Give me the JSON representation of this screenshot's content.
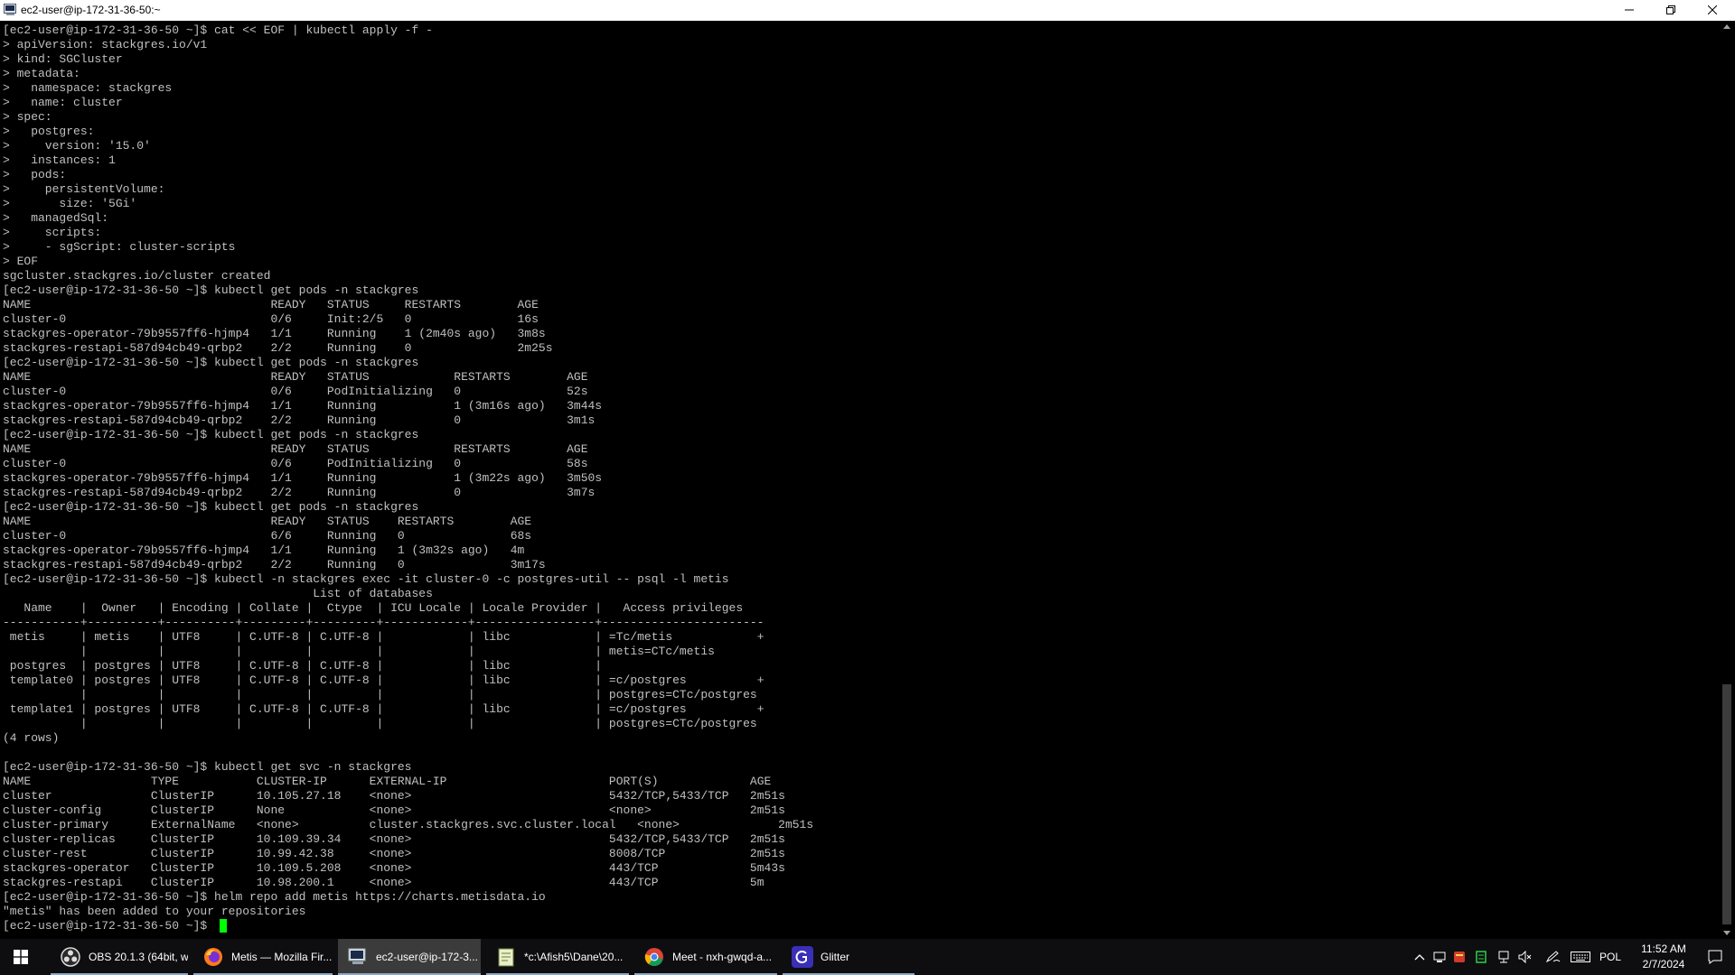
{
  "window": {
    "title": "ec2-user@ip-172-31-36-50:~"
  },
  "terminal": {
    "lines": [
      "[ec2-user@ip-172-31-36-50 ~]$ cat << EOF | kubectl apply -f -",
      "> apiVersion: stackgres.io/v1",
      "> kind: SGCluster",
      "> metadata:",
      ">   namespace: stackgres",
      ">   name: cluster",
      "> spec:",
      ">   postgres:",
      ">     version: '15.0'",
      ">   instances: 1",
      ">   pods:",
      ">     persistentVolume:",
      ">       size: '5Gi'",
      ">   managedSql:",
      ">     scripts:",
      ">     - sgScript: cluster-scripts",
      "> EOF",
      "sgcluster.stackgres.io/cluster created",
      "[ec2-user@ip-172-31-36-50 ~]$ kubectl get pods -n stackgres",
      "NAME                                  READY   STATUS     RESTARTS        AGE",
      "cluster-0                             0/6     Init:2/5   0               16s",
      "stackgres-operator-79b9557ff6-hjmp4   1/1     Running    1 (2m40s ago)   3m8s",
      "stackgres-restapi-587d94cb49-qrbp2    2/2     Running    0               2m25s",
      "[ec2-user@ip-172-31-36-50 ~]$ kubectl get pods -n stackgres",
      "NAME                                  READY   STATUS            RESTARTS        AGE",
      "cluster-0                             0/6     PodInitializing   0               52s",
      "stackgres-operator-79b9557ff6-hjmp4   1/1     Running           1 (3m16s ago)   3m44s",
      "stackgres-restapi-587d94cb49-qrbp2    2/2     Running           0               3m1s",
      "[ec2-user@ip-172-31-36-50 ~]$ kubectl get pods -n stackgres",
      "NAME                                  READY   STATUS            RESTARTS        AGE",
      "cluster-0                             0/6     PodInitializing   0               58s",
      "stackgres-operator-79b9557ff6-hjmp4   1/1     Running           1 (3m22s ago)   3m50s",
      "stackgres-restapi-587d94cb49-qrbp2    2/2     Running           0               3m7s",
      "[ec2-user@ip-172-31-36-50 ~]$ kubectl get pods -n stackgres",
      "NAME                                  READY   STATUS    RESTARTS        AGE",
      "cluster-0                             6/6     Running   0               68s",
      "stackgres-operator-79b9557ff6-hjmp4   1/1     Running   1 (3m32s ago)   4m",
      "stackgres-restapi-587d94cb49-qrbp2    2/2     Running   0               3m17s",
      "[ec2-user@ip-172-31-36-50 ~]$ kubectl -n stackgres exec -it cluster-0 -c postgres-util -- psql -l metis",
      "                                            List of databases",
      "   Name    |  Owner   | Encoding | Collate |  Ctype  | ICU Locale | Locale Provider |   Access privileges",
      "-----------+----------+----------+---------+---------+------------+-----------------+-----------------------",
      " metis     | metis    | UTF8     | C.UTF-8 | C.UTF-8 |            | libc            | =Tc/metis            +",
      "           |          |          |         |         |            |                 | metis=CTc/metis",
      " postgres  | postgres | UTF8     | C.UTF-8 | C.UTF-8 |            | libc            |",
      " template0 | postgres | UTF8     | C.UTF-8 | C.UTF-8 |            | libc            | =c/postgres          +",
      "           |          |          |         |         |            |                 | postgres=CTc/postgres",
      " template1 | postgres | UTF8     | C.UTF-8 | C.UTF-8 |            | libc            | =c/postgres          +",
      "           |          |          |         |         |            |                 | postgres=CTc/postgres",
      "(4 rows)",
      "",
      "[ec2-user@ip-172-31-36-50 ~]$ kubectl get svc -n stackgres",
      "NAME                 TYPE           CLUSTER-IP      EXTERNAL-IP                       PORT(S)             AGE",
      "cluster              ClusterIP      10.105.27.18    <none>                            5432/TCP,5433/TCP   2m51s",
      "cluster-config       ClusterIP      None            <none>                            <none>              2m51s",
      "cluster-primary      ExternalName   <none>          cluster.stackgres.svc.cluster.local   <none>              2m51s",
      "cluster-replicas     ClusterIP      10.109.39.34    <none>                            5432/TCP,5433/TCP   2m51s",
      "cluster-rest         ClusterIP      10.99.42.38     <none>                            8008/TCP            2m51s",
      "stackgres-operator   ClusterIP      10.109.5.208    <none>                            443/TCP             5m43s",
      "stackgres-restapi    ClusterIP      10.98.200.1     <none>                            443/TCP             5m",
      "[ec2-user@ip-172-31-36-50 ~]$ helm repo add metis https://charts.metisdata.io",
      "\"metis\" has been added to your repositories",
      "[ec2-user@ip-172-31-36-50 ~]$ "
    ]
  },
  "taskbar": {
    "apps": [
      {
        "label": "OBS 20.1.3 (64bit, w...",
        "icon": "obs-icon"
      },
      {
        "label": "Metis — Mozilla Fir...",
        "icon": "firefox-icon"
      },
      {
        "label": "ec2-user@ip-172-3...",
        "icon": "terminal-icon",
        "active": true
      },
      {
        "label": "*c:\\Afish5\\Dane\\20...",
        "icon": "notepad-icon"
      },
      {
        "label": "Meet - nxh-gwqd-a...",
        "icon": "chrome-icon"
      },
      {
        "label": "Glitter",
        "icon": "glitter-icon"
      }
    ],
    "tray": {
      "language": "POL",
      "time": "11:52 AM",
      "date": "2/7/2024"
    }
  },
  "colors": {
    "terminal_bg": "#000000",
    "terminal_text": "#c0c0c0",
    "cursor": "#00ff00",
    "taskbar_bg": "#0e0e11"
  }
}
